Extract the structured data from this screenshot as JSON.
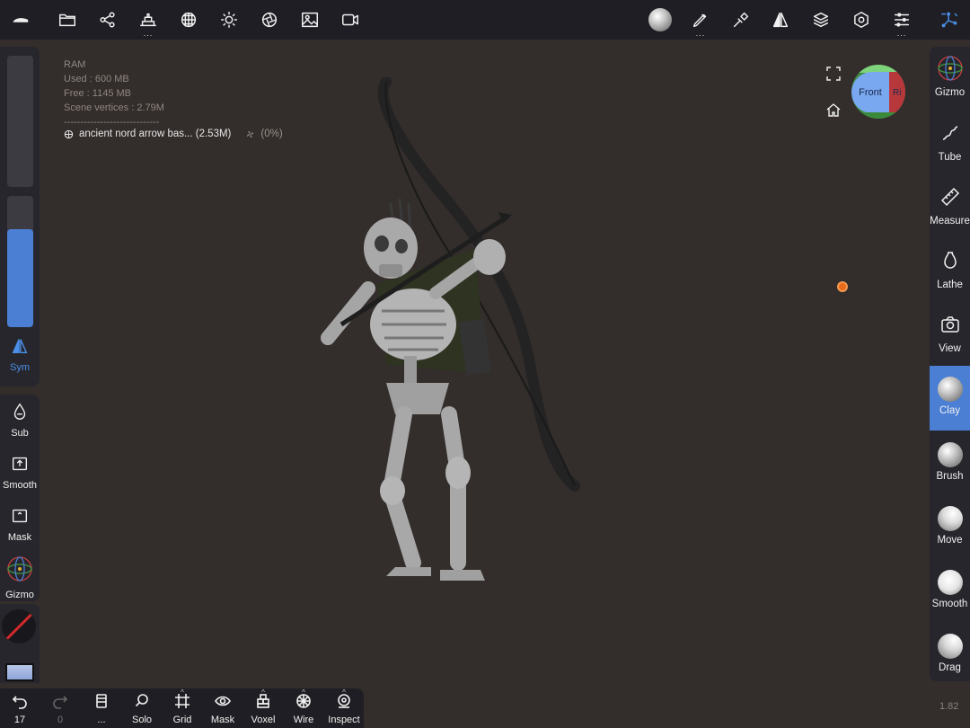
{
  "topbar": {
    "icons": [
      "nomad-logo-icon",
      "folder-icon",
      "scene-graph-icon",
      "primitives-icon",
      "material-icon",
      "light-icon",
      "shading-icon",
      "background-icon",
      "video-icon",
      "matcap-sphere-icon",
      "paint-icon",
      "tools-icon",
      "symmetry-icon",
      "layers-icon",
      "settings-icon",
      "sliders-icon",
      "gizmo-icon"
    ]
  },
  "left_panel": {
    "sym_label": "Sym",
    "tools": [
      {
        "label": "Sub",
        "icon": "drop-icon"
      },
      {
        "label": "Smooth",
        "icon": "smooth-icon"
      },
      {
        "label": "Mask",
        "icon": "mask-icon"
      },
      {
        "label": "Gizmo",
        "icon": "gizmo-icon"
      }
    ],
    "radius_fraction": 0.0,
    "intensity_fraction": 0.75
  },
  "info": {
    "ram": "RAM",
    "used": "Used : 600 MB",
    "free": "Free : 1145 MB",
    "vertices": "Scene vertices : 2.79M",
    "separator": "-----------------------------",
    "mesh_name": "ancient nord arrow bas... (2.53M)",
    "mesh_pct": "(0%)"
  },
  "viewcube": {
    "front": "Front",
    "right": "Ri"
  },
  "right_panel": {
    "tools": [
      {
        "label": "Gizmo",
        "icon": "gizmo-icon"
      },
      {
        "label": "Tube",
        "icon": "tube-icon"
      },
      {
        "label": "Measure",
        "icon": "ruler-icon"
      },
      {
        "label": "Lathe",
        "icon": "lathe-icon"
      },
      {
        "label": "View",
        "icon": "camera-icon"
      },
      {
        "label": "Clay",
        "icon": "clay-sphere-icon",
        "active": true
      },
      {
        "label": "Brush",
        "icon": "brush-sphere-icon"
      },
      {
        "label": "Move",
        "icon": "move-sphere-icon"
      },
      {
        "label": "Smooth",
        "icon": "smooth-sphere-icon"
      },
      {
        "label": "Drag",
        "icon": "drag-sphere-icon"
      }
    ]
  },
  "bottombar": {
    "undo": "17",
    "redo": "0",
    "items": [
      {
        "label": "...",
        "icon": "book-icon"
      },
      {
        "label": "Solo",
        "icon": "magnifier-icon"
      },
      {
        "label": "Grid",
        "icon": "grid-icon"
      },
      {
        "label": "Mask",
        "icon": "eye-icon"
      },
      {
        "label": "Voxel",
        "icon": "voxel-icon"
      },
      {
        "label": "Wire",
        "icon": "wire-icon"
      },
      {
        "label": "Inspect",
        "icon": "inspect-icon"
      }
    ]
  },
  "zoom": "1.82",
  "colors": {
    "accent": "#4a7fd4",
    "panel": "#27262c",
    "bar": "#1f1e24",
    "viewport": "#332d2b",
    "pivot": "#e86a1a"
  }
}
